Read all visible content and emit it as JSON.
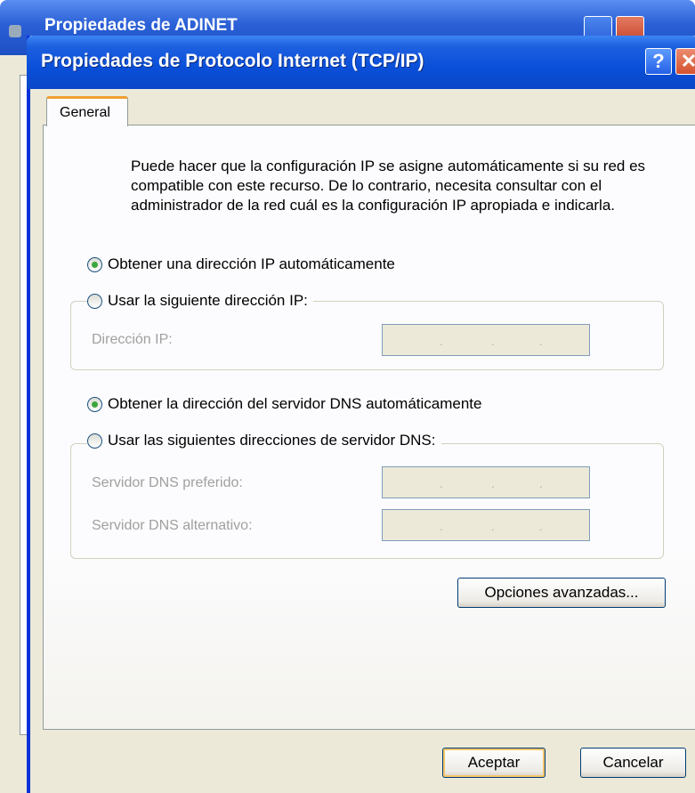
{
  "background_window": {
    "title": "Propiedades de ADINET"
  },
  "dialog": {
    "title": "Propiedades de Protocolo Internet (TCP/IP)",
    "help_label": "?",
    "close_label": "✕",
    "tab_general": "General",
    "description": "Puede hacer que la configuración IP se asigne automáticamente si su red es compatible con este recurso. De lo contrario, necesita consultar con el administrador de la red cuál es la configuración IP apropiada e indicarla.",
    "ip": {
      "auto_label": "Obtener una dirección IP automáticamente",
      "auto_selected": true,
      "manual_label": "Usar la siguiente dirección IP:",
      "address_label": "Dirección IP:",
      "address_value": ". . ."
    },
    "dns": {
      "auto_label": "Obtener la dirección del servidor DNS automáticamente",
      "auto_selected": true,
      "manual_label": "Usar las siguientes direcciones de servidor DNS:",
      "preferred_label": "Servidor DNS preferido:",
      "alternate_label": "Servidor DNS alternativo:"
    },
    "advanced_button": "Opciones avanzadas...",
    "ok_button": "Aceptar",
    "cancel_button": "Cancelar"
  },
  "colors": {
    "titlebar": "#0a4fd9",
    "dialog_bg": "#ece9d8",
    "radio_dot": "#3ca63c",
    "tab_highlight": "#f0a030"
  }
}
